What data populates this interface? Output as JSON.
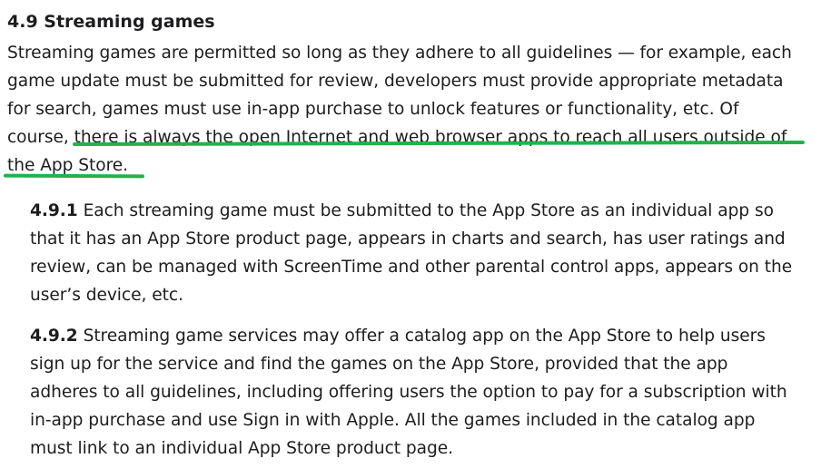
{
  "section": {
    "heading": "4.9 Streaming games",
    "intro_lines": [
      "Streaming games are permitted so long as they adhere to all guidelines — for example, each",
      "game update must be submitted for review, developers must provide appropriate metadata",
      "for search, games must use in-app purchase to unlock features or functionality, etc. Of"
    ],
    "intro_line4_prefix": "course, ",
    "highlighted_line4": "there is always the open Internet and web browser apps to reach all users outside of",
    "highlighted_line5": "the App Store.",
    "highlight_color": "#22b14c"
  },
  "subsections": [
    {
      "number": "4.9.1",
      "first_line": " Each streaming game must be submitted to the App Store as an individual app so",
      "lines": [
        "that it has an App Store product page, appears in charts and search, has user ratings and",
        "review, can be managed with ScreenTime and other parental control apps, appears on the",
        "user’s device, etc."
      ]
    },
    {
      "number": "4.9.2",
      "first_line": " Streaming game services may offer a catalog app on the App Store to help users",
      "lines": [
        "sign up for the service and find the games on the App Store, provided that the app",
        "adheres to all guidelines, including offering users the option to pay for a subscription with",
        "in-app purchase and use Sign in with Apple. All the games included in the catalog app",
        "must link to an individual App Store product page."
      ]
    }
  ]
}
